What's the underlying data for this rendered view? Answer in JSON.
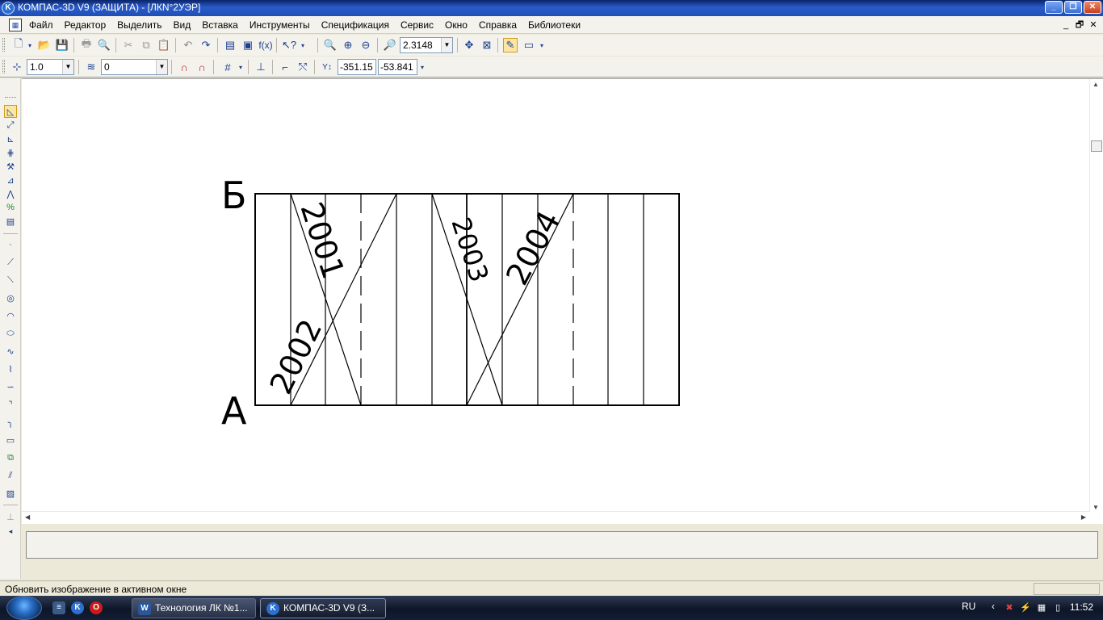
{
  "window": {
    "title": "КОМПАС-3D V9 (ЗАЩИТА) - [ЛКN°2УЭР]",
    "app_icon": "kompas-logo-icon",
    "controls": [
      "minimize-icon",
      "restore-icon",
      "close-icon"
    ]
  },
  "menu": {
    "items": [
      "Файл",
      "Редактор",
      "Выделить",
      "Вид",
      "Вставка",
      "Инструменты",
      "Спецификация",
      "Сервис",
      "Окно",
      "Справка",
      "Библиотеки"
    ],
    "doc_controls": [
      "_",
      "🗗",
      "✕"
    ]
  },
  "toolbar_standard": {
    "zoom_value": "2.3148"
  },
  "toolbar_current_state": {
    "step": "1.0",
    "layer": "0",
    "coord_x": "-351.15",
    "coord_y": "-53.841"
  },
  "drawing": {
    "label_top": "Б",
    "label_bottom": "А",
    "annotations": [
      "2001",
      "2002",
      "2003",
      "2004"
    ]
  },
  "status": {
    "message": "Обновить изображение в активном окне"
  },
  "taskbar": {
    "buttons": [
      "Технология ЛК №1...",
      "КОМПАС-3D V9 (З..."
    ],
    "language": "RU",
    "clock": "11:52"
  },
  "colors": {
    "titlebar": "#1e4fb8",
    "taskbar": "#0e1628",
    "chrome": "#ece9d8"
  }
}
